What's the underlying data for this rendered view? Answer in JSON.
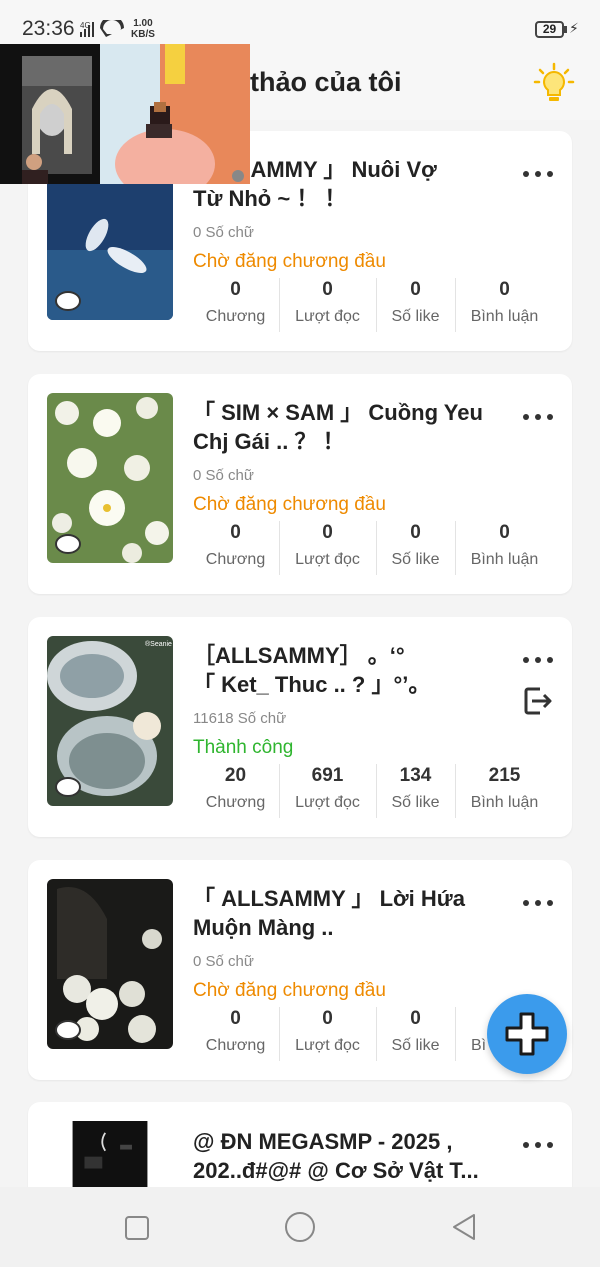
{
  "status_bar": {
    "time": "23:36",
    "network": "4G",
    "speed_value": "1.00",
    "speed_unit": "KB/S",
    "battery": "29"
  },
  "header": {
    "title": "thảo của tôi"
  },
  "stat_labels": {
    "chapters": "Chương",
    "reads": "Lượt đọc",
    "likes": "Số like",
    "comments": "Bình luận"
  },
  "stories": [
    {
      "title_line1": "ALLSAMMY 」 Nuôi Vợ",
      "title_line2": "Từ Nhỏ ~ ！ ！",
      "words": "0 Số chữ",
      "status": "Chờ đăng chương đầu",
      "chapters": "0",
      "reads": "0",
      "likes": "0",
      "comments": "0"
    },
    {
      "title_line1": "「 SIM × SAM 」 Cuồng Yeu",
      "title_line2": "Chj Gái .. ？ ！",
      "words": "0 Số chữ",
      "status": "Chờ đăng chương đầu",
      "chapters": "0",
      "reads": "0",
      "likes": "0",
      "comments": "0"
    },
    {
      "title_line1": "［ALLSAMMY］ 。‘°",
      "title_line2": "「 Ket_ Thuc .. ? 」°’。",
      "words": "11618 Số chữ",
      "status": "Thành công",
      "chapters": "20",
      "reads": "691",
      "likes": "134",
      "comments": "215"
    },
    {
      "title_line1": "「 ALLSAMMY 」 Lời Hứa",
      "title_line2": "Muộn Màng ..",
      "words": "0 Số chữ",
      "status": "Chờ đăng chương đầu",
      "chapters": "0",
      "reads": "0",
      "likes": "0",
      "comments": "Bì"
    },
    {
      "title_line1": "@ ĐN MEGASMP - 2025 ,",
      "title_line2": "202..đ#@# @ Cơ Sở Vật T..."
    }
  ],
  "colors": {
    "accent": "#3b9bec",
    "pending": "#ee8a00",
    "success": "#2fb52f"
  }
}
